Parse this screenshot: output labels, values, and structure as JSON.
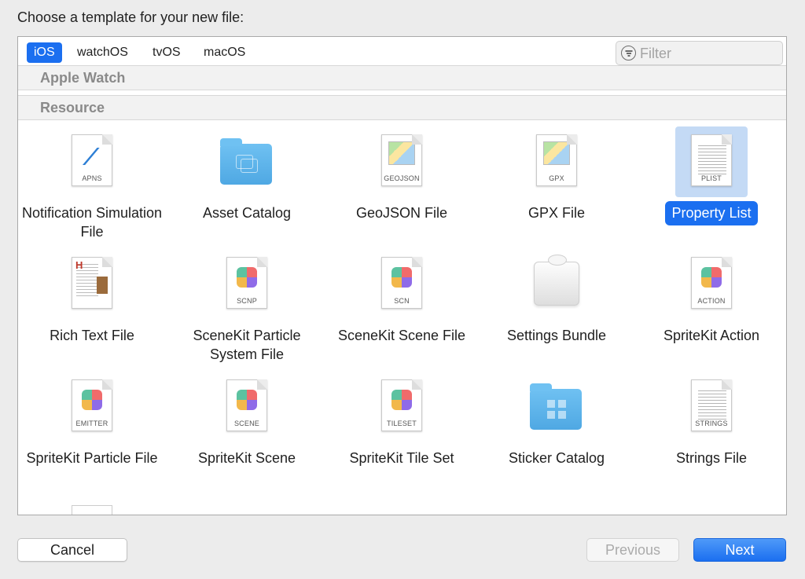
{
  "dialog": {
    "prompt": "Choose a template for your new file:"
  },
  "tabs": [
    {
      "label": "iOS",
      "active": true
    },
    {
      "label": "watchOS",
      "active": false
    },
    {
      "label": "tvOS",
      "active": false
    },
    {
      "label": "macOS",
      "active": false
    }
  ],
  "filter": {
    "placeholder": "Filter",
    "value": ""
  },
  "sections": {
    "apple_watch": "Apple Watch",
    "resource": "Resource"
  },
  "templates": [
    {
      "label": "Notification Simulation File",
      "badge": "APNS",
      "icon": "apns-document-icon"
    },
    {
      "label": "Asset Catalog",
      "badge": "",
      "icon": "asset-catalog-folder-icon"
    },
    {
      "label": "GeoJSON File",
      "badge": "GEOJSON",
      "icon": "geojson-document-icon"
    },
    {
      "label": "GPX File",
      "badge": "GPX",
      "icon": "gpx-document-icon"
    },
    {
      "label": "Property List",
      "badge": "PLIST",
      "icon": "plist-document-icon",
      "selected": true
    },
    {
      "label": "Rich Text File",
      "badge": "",
      "icon": "rich-text-document-icon"
    },
    {
      "label": "SceneKit Particle System File",
      "badge": "SCNP",
      "icon": "scnp-document-icon"
    },
    {
      "label": "SceneKit Scene File",
      "badge": "SCN",
      "icon": "scn-document-icon"
    },
    {
      "label": "Settings Bundle",
      "badge": "",
      "icon": "settings-bundle-icon"
    },
    {
      "label": "SpriteKit Action",
      "badge": "ACTION",
      "icon": "action-document-icon"
    },
    {
      "label": "SpriteKit Particle File",
      "badge": "EMITTER",
      "icon": "emitter-document-icon"
    },
    {
      "label": "SpriteKit Scene",
      "badge": "SCENE",
      "icon": "scene-document-icon"
    },
    {
      "label": "SpriteKit Tile Set",
      "badge": "TILESET",
      "icon": "tileset-document-icon"
    },
    {
      "label": "Sticker Catalog",
      "badge": "",
      "icon": "sticker-catalog-folder-icon"
    },
    {
      "label": "Strings File",
      "badge": "STRINGS",
      "icon": "strings-document-icon"
    }
  ],
  "buttons": {
    "cancel": "Cancel",
    "previous": "Previous",
    "next": "Next"
  },
  "colors": {
    "accent": "#1b6ff0",
    "selection_bg": "#c4daf5"
  }
}
